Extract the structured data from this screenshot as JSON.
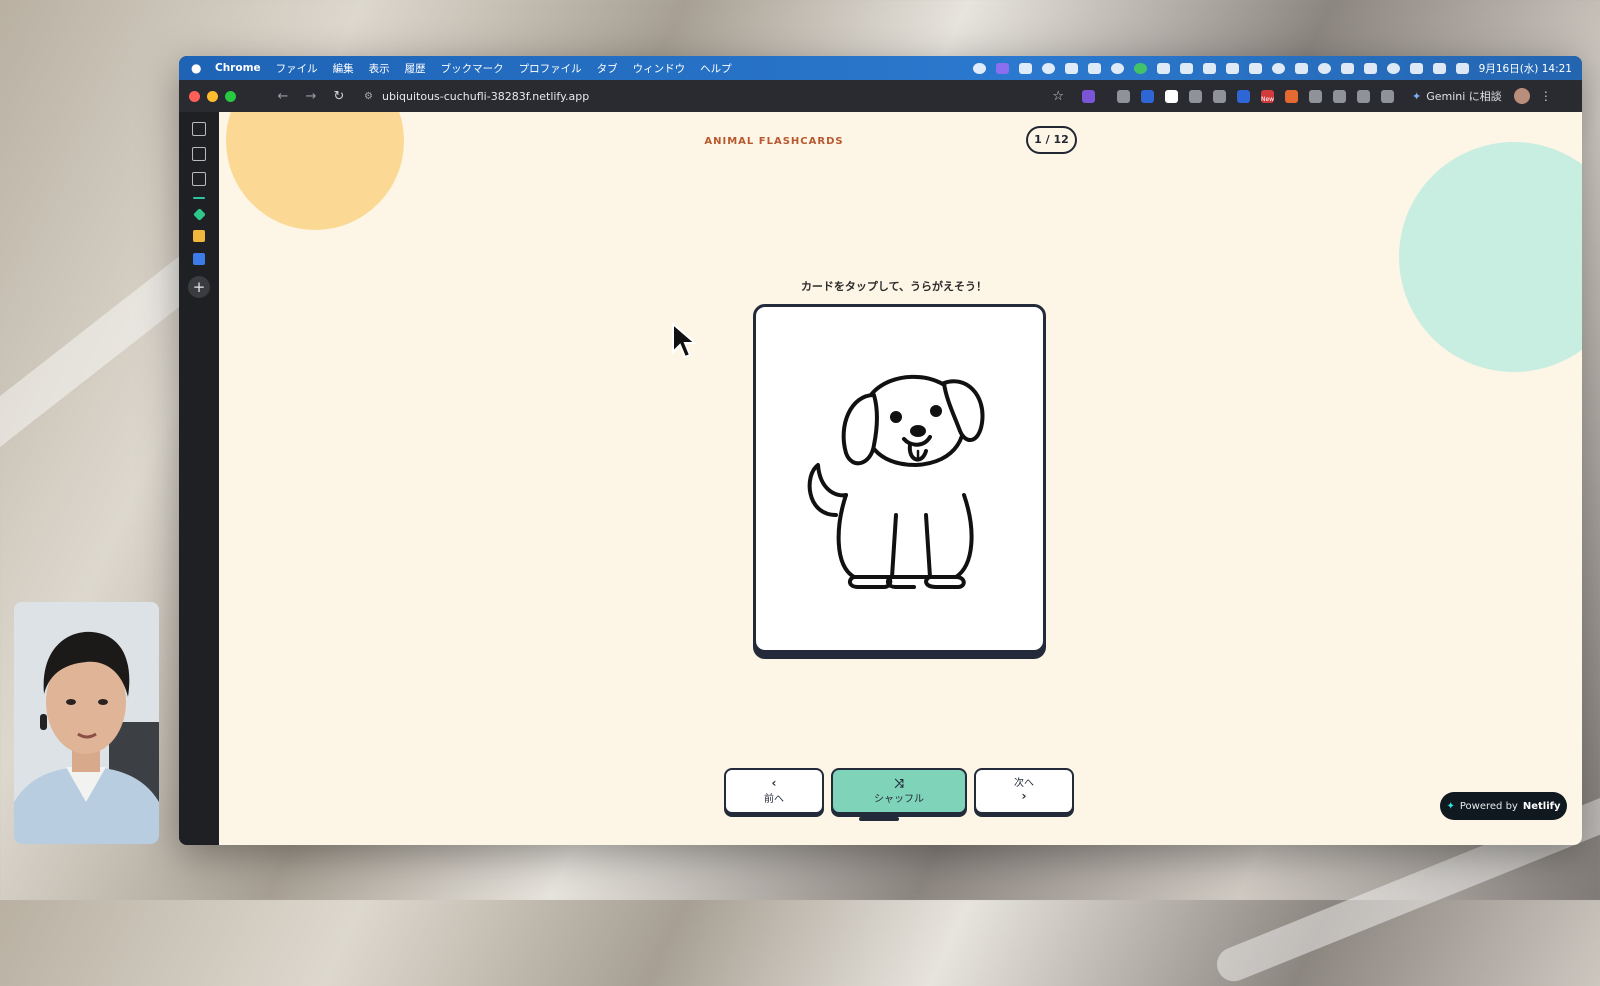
{
  "menubar": {
    "items": [
      "Chrome",
      "ファイル",
      "編集",
      "表示",
      "履歴",
      "ブックマーク",
      "プロファイル",
      "タブ",
      "ウィンドウ",
      "ヘルプ"
    ],
    "clock": "9月16日(水) 14:21"
  },
  "toolbar": {
    "url": "ubiquitous-cuchufli-38283f.netlify.app",
    "gemini_label": "Gemini に相談",
    "extension_badge": "New"
  },
  "page": {
    "title": "ANIMAL FLASHCARDS",
    "counter": "1 / 12",
    "hint": "カードをタップして、うらがえそう！",
    "card_icon": "dog-illustration",
    "buttons": {
      "prev_label": "前へ",
      "shuffle_label": "シャッフル",
      "next_label": "次へ"
    },
    "netlify_badge": {
      "prefix": "Powered by",
      "brand": "Netlify"
    }
  }
}
